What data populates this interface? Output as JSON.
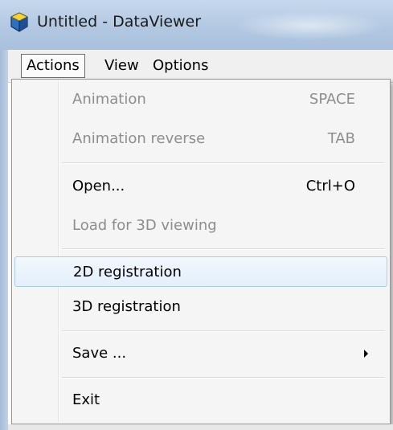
{
  "window": {
    "title": "Untitled - DataViewer",
    "icon": "app-cube-icon"
  },
  "menubar": {
    "items": [
      "Actions",
      "View",
      "Options"
    ]
  },
  "menu": {
    "items": [
      {
        "label": "Animation",
        "shortcut": "SPACE",
        "enabled": false
      },
      {
        "label": "Animation reverse",
        "shortcut": "TAB",
        "enabled": false
      },
      {
        "label": "Open...",
        "shortcut": "Ctrl+O",
        "enabled": true
      },
      {
        "label": "Load for 3D viewing",
        "shortcut": "",
        "enabled": false
      },
      {
        "label": "2D registration",
        "shortcut": "",
        "enabled": true,
        "highlighted": true
      },
      {
        "label": "3D registration",
        "shortcut": "",
        "enabled": true
      },
      {
        "label": "Save ...",
        "shortcut": "",
        "enabled": true,
        "submenu": true,
        "submenu_icon": "chevron-right-icon"
      },
      {
        "label": "Exit",
        "shortcut": "",
        "enabled": true
      }
    ]
  },
  "colors": {
    "highlight_border": "#a8cbef",
    "highlight_fill": "#e3effb",
    "disabled_text": "#8d8d8d",
    "titlebar": "#b2c8e2"
  }
}
